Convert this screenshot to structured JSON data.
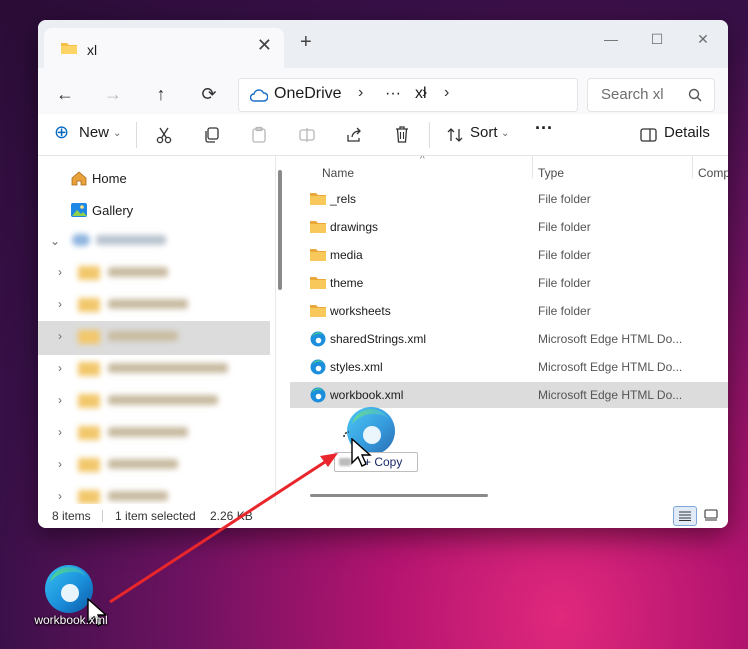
{
  "window": {
    "tab_title": "xl",
    "tab_close": "✕",
    "new_tab": "+",
    "controls": {
      "minimize": "—",
      "maximize": "☐",
      "close": "✕"
    }
  },
  "nav": {
    "back": "←",
    "forward": "→",
    "up": "↑",
    "refresh": "⟳"
  },
  "breadcrumb": {
    "items": [
      "OneDrive",
      "···",
      "xl"
    ],
    "separator": "›"
  },
  "search": {
    "placeholder": "Search xl"
  },
  "toolbar": {
    "new_label": "New",
    "sort_label": "Sort",
    "more_label": "···",
    "details_label": "Details"
  },
  "sidebar": {
    "items": [
      {
        "label": "Home",
        "icon": "home-icon"
      },
      {
        "label": "Gallery",
        "icon": "gallery-icon"
      }
    ],
    "blurred_rows": 9
  },
  "columns": {
    "name": "Name",
    "type": "Type",
    "comp": "Comp"
  },
  "files": [
    {
      "name": "_rels",
      "type": "File folder",
      "kind": "folder"
    },
    {
      "name": "drawings",
      "type": "File folder",
      "kind": "folder"
    },
    {
      "name": "media",
      "type": "File folder",
      "kind": "folder"
    },
    {
      "name": "theme",
      "type": "File folder",
      "kind": "folder"
    },
    {
      "name": "worksheets",
      "type": "File folder",
      "kind": "folder"
    },
    {
      "name": "sharedStrings.xml",
      "type": "Microsoft Edge HTML Do...",
      "kind": "edge"
    },
    {
      "name": "styles.xml",
      "type": "Microsoft Edge HTML Do...",
      "kind": "edge"
    },
    {
      "name": "workbook.xml",
      "type": "Microsoft Edge HTML Do...",
      "kind": "edge",
      "selected": true
    }
  ],
  "status": {
    "count": "8 items",
    "selected": "1 item selected",
    "size": "2.26 KB"
  },
  "drag": {
    "tooltip": "+ Copy"
  },
  "desktop": {
    "icon_label": "workbook.xml"
  },
  "colors": {
    "accent": "#0067c0",
    "arrow": "#e8262c",
    "folder": "#f5c04a"
  }
}
